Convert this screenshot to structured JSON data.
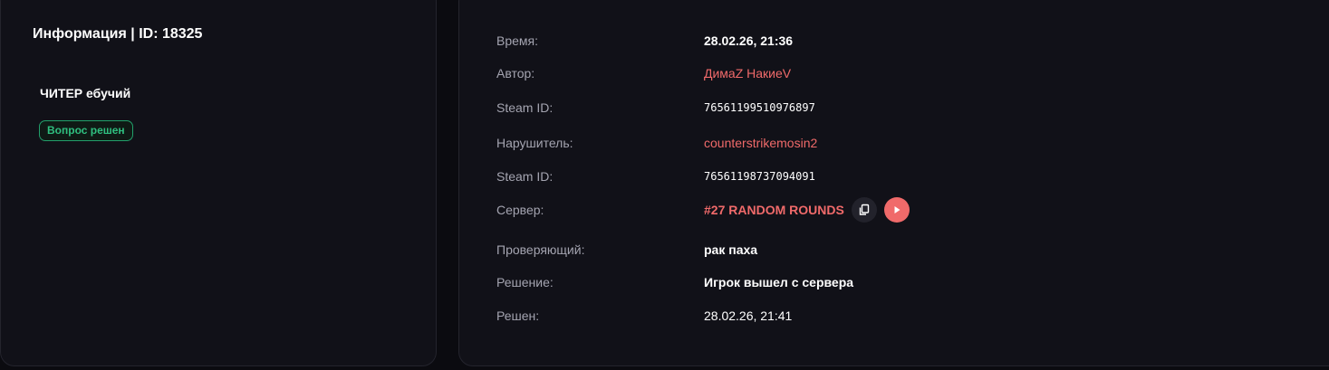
{
  "info_panel": {
    "title": "Информация | ID: 18325",
    "complaint": "ЧИТЕР ебучий",
    "status": "Вопрос решен",
    "status_color": "#2fbf7f"
  },
  "details": {
    "time": {
      "label": "Время:",
      "value": "28.02.26, 21:36"
    },
    "author": {
      "label": "Автор:",
      "value": "ДимаZ НакиеV"
    },
    "author_steam": {
      "label": "Steam ID:",
      "value": "76561199510976897"
    },
    "violator": {
      "label": "Нарушитель:",
      "value": "counterstrikemosin2"
    },
    "violator_steam": {
      "label": "Steam ID:",
      "value": "76561198737094091"
    },
    "server": {
      "label": "Сервер:",
      "value": "#27 RANDOM ROUNDS",
      "copy_icon": "copy-icon",
      "play_icon": "play-icon"
    },
    "reviewer": {
      "label": "Проверяющий:",
      "value": "рак паха"
    },
    "decision": {
      "label": "Решение:",
      "value": "Игрок вышел с сервера"
    },
    "resolved": {
      "label": "Решен:",
      "value": "28.02.26, 21:41"
    }
  },
  "colors": {
    "background": "#0b0b10",
    "panel": "#111118",
    "accent_red": "#f06a6a",
    "label": "#a4a4b0"
  }
}
